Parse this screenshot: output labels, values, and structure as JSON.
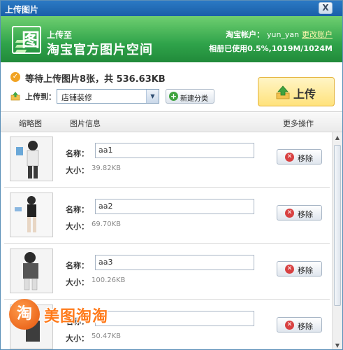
{
  "window": {
    "title": "上传图片",
    "close_glyph": "X"
  },
  "banner": {
    "upload_to": "上传至",
    "space_name": "淘宝官方图片空间",
    "account_label": "淘宝帐户：",
    "account_user": "yun_yan",
    "change_account": "更改账户",
    "album_usage": "相册已使用0.5%,1019M/1024M"
  },
  "info": {
    "waiting_text": "等待上传图片8张，共  536.63KB",
    "upload_to_label": "上传到：",
    "category_value": "店铺装修",
    "new_category_button": "新建分类",
    "upload_button": "上传"
  },
  "columns": {
    "thumbnail": "缩略图",
    "info": "图片信息",
    "more": "更多操作"
  },
  "items": [
    {
      "name_label": "名称：",
      "name": "aa1",
      "size_label": "大小：",
      "size": "39.82KB",
      "remove": "移除"
    },
    {
      "name_label": "名称：",
      "name": "aa2",
      "size_label": "大小：",
      "size": "69.70KB",
      "remove": "移除"
    },
    {
      "name_label": "名称：",
      "name": "aa3",
      "size_label": "大小：",
      "size": "100.26KB",
      "remove": "移除"
    },
    {
      "name_label": "名称：",
      "name": "",
      "size_label": "大小：",
      "size": "50.47KB",
      "remove": "移除"
    }
  ],
  "watermark": {
    "badge": "淘",
    "text": "美图淘淘"
  },
  "colors": {
    "banner_green": "#2fa34a",
    "titlebar_blue": "#1a5fa8",
    "upload_yellow": "#ffe27c",
    "watermark_orange": "#ff7a1a"
  }
}
